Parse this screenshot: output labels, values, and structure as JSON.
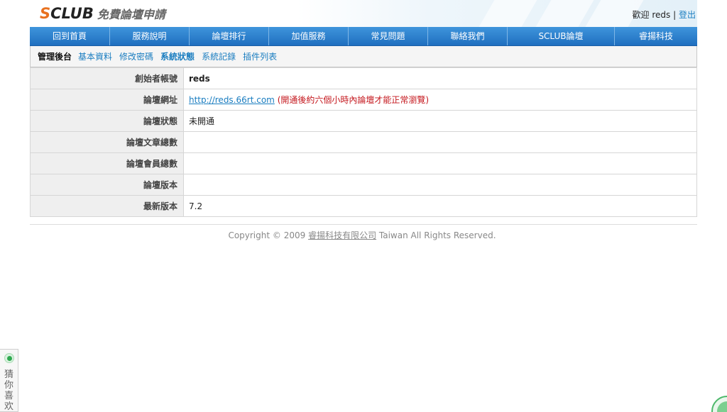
{
  "header": {
    "logo_mark_s": "S",
    "logo_mark_rest": "CLUB",
    "logo_subtitle": "免費論壇申請",
    "welcome_prefix": "歡迎",
    "username": "reds",
    "separator": "|",
    "logout_label": "登出"
  },
  "nav": {
    "items": [
      {
        "label": "回到首頁"
      },
      {
        "label": "服務說明"
      },
      {
        "label": "論壇排行"
      },
      {
        "label": "加值服務"
      },
      {
        "label": "常見問題"
      },
      {
        "label": "聯絡我們"
      },
      {
        "label": "SCLUB論壇"
      },
      {
        "label": "睿揚科技"
      }
    ]
  },
  "subnav": {
    "title": "管理後台",
    "links": [
      {
        "label": "基本資料",
        "active": false
      },
      {
        "label": "修改密碼",
        "active": false
      },
      {
        "label": "系統狀態",
        "active": true
      },
      {
        "label": "系統記錄",
        "active": false
      },
      {
        "label": "插件列表",
        "active": false
      }
    ]
  },
  "info": {
    "rows": [
      {
        "label": "創始者帳號",
        "value": "reds"
      },
      {
        "label": "論壇網址",
        "value": "http://reds.66rt.com",
        "note": "(開通後約六個小時內論壇才能正常瀏覽)"
      },
      {
        "label": "論壇狀態",
        "value": "未開通"
      },
      {
        "label": "論壇文章總數",
        "value": ""
      },
      {
        "label": "論壇會員總數",
        "value": ""
      },
      {
        "label": "論壇版本",
        "value": ""
      },
      {
        "label": "最新版本",
        "value": "7.2"
      }
    ]
  },
  "footer": {
    "prefix": "Copyright © 2009 ",
    "company": "睿揚科技有限公司",
    "suffix": " Taiwan All Rights Reserved."
  },
  "side_widget": {
    "label": "猜你喜欢"
  },
  "colors": {
    "nav_bg": "#2a7fd0",
    "link": "#1a7dc0",
    "logo_accent": "#e8711f",
    "note": "#c4161c"
  },
  "icons": {
    "side_widget_status": "green-dot-icon",
    "corner_badge": "green-circle-icon"
  }
}
